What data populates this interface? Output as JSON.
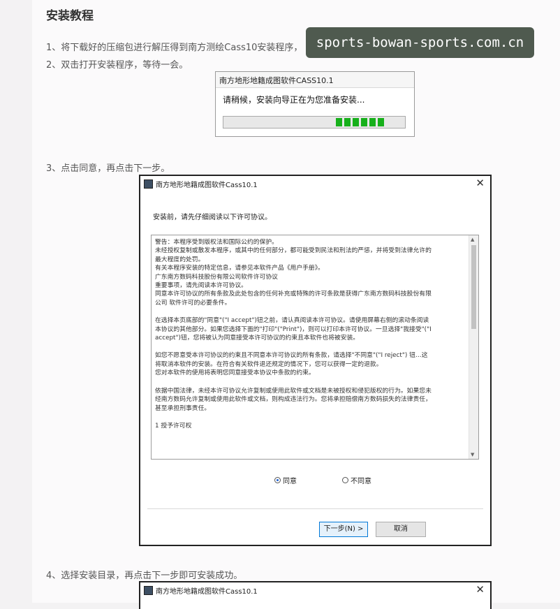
{
  "article": {
    "heading": "安装教程",
    "step1": "1、将下载好的压缩包进行解压得到南方测绘Cass10安装程序，",
    "step2": "2、双击打开安装程序，等待一会。",
    "step3": "3、点击同意，再点击下一步。",
    "step4": "4、选择安装目录，再点击下一步即可安装成功。"
  },
  "watermark": {
    "text": "sports-bowan-sports.com.cn"
  },
  "progress_dialog": {
    "title": "南方地形地籍成图软件CASS10.1",
    "message": "请稍候，安装向导正在为您准备安装...",
    "progress": 0.28,
    "fill_color": "#17b01b"
  },
  "license_dialog": {
    "title": "南方地形地籍成图软件Cass10.1",
    "close_icon": "close-icon",
    "intro": "安装前，请先仔细阅读以下许可协议。",
    "paragraphs": [
      [
        "警告：本程序受到版权法和国际公约的保护。",
        "未经授权复制或散发本程序，或其中的任何部分，都可能受到民法和刑法的严惩，并将受到法律允许的",
        "最大程度的处罚。",
        "有关本程序安装的特定信息，请参见本软件产品《用户手册》。",
        "广东南方数码科技股份有限公司软件许可协议",
        "重要事项，请先阅读本许可协议。",
        "同意本许可协议的所有条款及此处包含的任何补充或特殊的许可条款是获得广东南方数码科技股份有限",
        "公司 软件许可的必要条件。"
      ],
      [
        "在选择本页底部的\"同意\"(\"I accept\")钮之前，请认真阅读本许可协议。请使用屏幕右侧的滚动条阅读",
        "本协议的其他部分。如果您选择下面的\"打印\"(\"Print\")，则可以打印本许可协议。一旦选择\"我接受\"(\"I",
        "accept\")钮，您将被认为同意接受本许可协议的约束且本软件也将被安装。"
      ],
      [
        "如您不愿意受本许可协议的约束且不同意本许可协议的所有条款，请选择\"不同意\"(\"I reject\") 钮…这",
        "将取消本软件的安装。在符合有关软件退还规定的情况下，您可以获得一定的退款。",
        "您对本软件的使用将表明您同意接受本协议中条款的约束。"
      ],
      [
        "依据中国法律，未经本许可协议允许复制或使用此软件或文档是未被授权和侵犯版权的行为。如果您未",
        "经南方数码允许复制或使用此软件或文档，则构成违法行为。您将承担赔偿南方数码损失的法律责任，",
        "甚至承担刑事责任。"
      ],
      [
        "1          授予许可权"
      ]
    ],
    "radio_agree": "同意",
    "radio_disagree": "不同意",
    "selected": "同意",
    "next_button": "下一步(N) >",
    "cancel_button": "取消"
  },
  "bottom_dialog": {
    "title": "南方地形地籍成图软件Cass10.1"
  }
}
